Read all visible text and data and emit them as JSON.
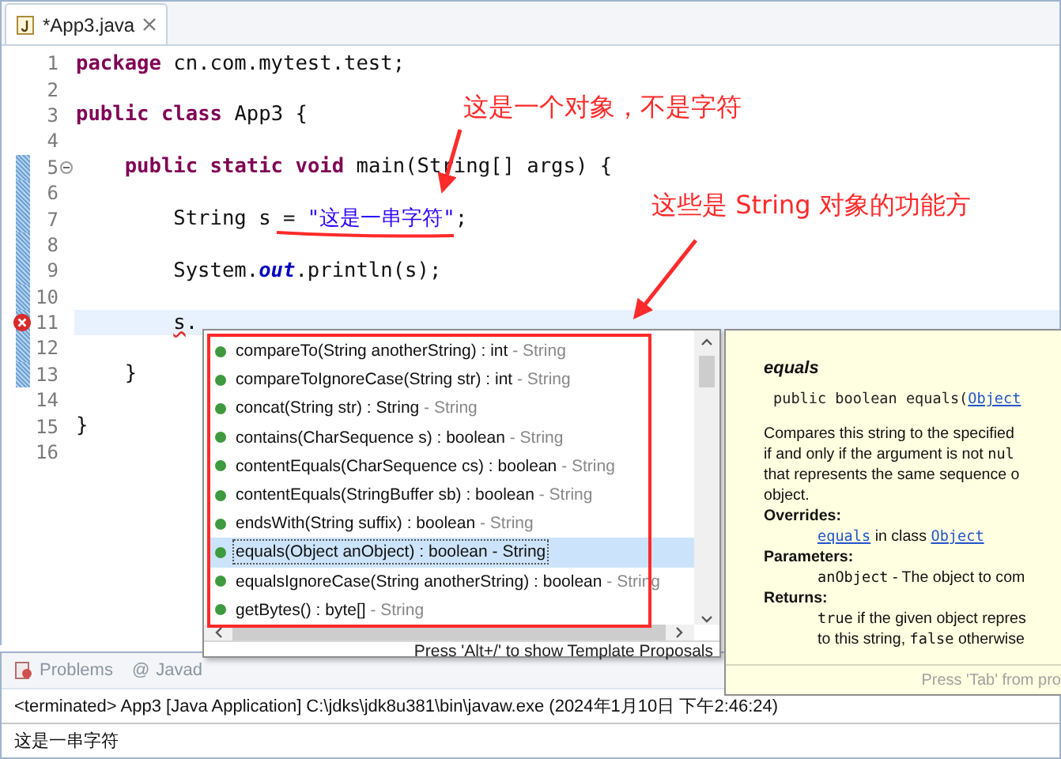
{
  "editor_tab": {
    "title": "*App3.java"
  },
  "code_lines": [
    {
      "number": "1",
      "tokens": [
        {
          "text": "package",
          "kind": "keyword"
        },
        {
          "text": " cn.com.mytest.test;",
          "kind": "plain"
        }
      ],
      "changed": false,
      "foldable": false,
      "error": false,
      "current": false
    },
    {
      "number": "2",
      "changed": false,
      "foldable": false,
      "error": false,
      "current": false
    },
    {
      "number": "3",
      "tokens": [
        {
          "text": "public ",
          "kind": "keyword"
        },
        {
          "text": "class ",
          "kind": "keyword"
        },
        {
          "text": "App3 {",
          "kind": "plain"
        }
      ],
      "changed": false,
      "foldable": false,
      "error": false,
      "current": false
    },
    {
      "number": "4",
      "changed": false,
      "foldable": false,
      "error": false,
      "current": false
    },
    {
      "number": "5",
      "tokens": [
        {
          "text": "    public ",
          "kind": "keyword"
        },
        {
          "text": "static ",
          "kind": "keyword"
        },
        {
          "text": "void",
          "kind": "keyword"
        },
        {
          "text": " main(String[] args) {",
          "kind": "plain"
        }
      ],
      "changed": true,
      "foldable": true,
      "error": false,
      "current": false
    },
    {
      "number": "6",
      "changed": true,
      "foldable": false,
      "error": false,
      "current": false
    },
    {
      "number": "7",
      "tokens": [
        {
          "text": "        String s = ",
          "kind": "plain"
        },
        {
          "text": "\"这是一串字符\"",
          "kind": "string"
        },
        {
          "text": ";",
          "kind": "plain"
        }
      ],
      "changed": true,
      "foldable": false,
      "error": false,
      "current": false
    },
    {
      "number": "8",
      "changed": true,
      "foldable": false,
      "error": false,
      "current": false
    },
    {
      "number": "9",
      "tokens": [
        {
          "text": "        System.",
          "kind": "plain"
        },
        {
          "text": "out",
          "kind": "field"
        },
        {
          "text": ".println(s);",
          "kind": "plain"
        }
      ],
      "changed": true,
      "foldable": false,
      "error": false,
      "current": false
    },
    {
      "number": "10",
      "changed": true,
      "foldable": false,
      "error": false,
      "current": false
    },
    {
      "number": "11",
      "tokens": [
        {
          "text": "        s",
          "kind": "error"
        },
        {
          "text": ".",
          "kind": "plain"
        }
      ],
      "changed": true,
      "foldable": false,
      "error": true,
      "current": true
    },
    {
      "number": "12",
      "changed": true,
      "foldable": false,
      "error": false,
      "current": false
    },
    {
      "number": "13",
      "tokens": [
        {
          "text": "    }",
          "kind": "plain"
        }
      ],
      "changed": true,
      "foldable": false,
      "error": false,
      "current": false
    },
    {
      "number": "14",
      "changed": false,
      "foldable": false,
      "error": false,
      "current": false
    },
    {
      "number": "15",
      "tokens": [
        {
          "text": "}",
          "kind": "plain"
        }
      ],
      "changed": false,
      "foldable": false,
      "error": false,
      "current": false
    },
    {
      "number": "16",
      "changed": false,
      "foldable": false,
      "error": false,
      "current": false
    }
  ],
  "completion_popup": {
    "items": [
      {
        "signature": "compareTo(String anotherString) : int",
        "qualifier": "- String",
        "selected": false
      },
      {
        "signature": "compareToIgnoreCase(String str) : int",
        "qualifier": "- String",
        "selected": false
      },
      {
        "signature": "concat(String str) : String",
        "qualifier": "- String",
        "selected": false
      },
      {
        "signature": "contains(CharSequence s) : boolean",
        "qualifier": "- String",
        "selected": false
      },
      {
        "signature": "contentEquals(CharSequence cs) : boolean",
        "qualifier": "- String",
        "selected": false
      },
      {
        "signature": "contentEquals(StringBuffer sb) : boolean",
        "qualifier": "- String",
        "selected": false
      },
      {
        "signature": "endsWith(String suffix) : boolean",
        "qualifier": "- String",
        "selected": false
      },
      {
        "signature": "equals(Object anObject) : boolean",
        "qualifier": "- String",
        "selected": true
      },
      {
        "signature": "equalsIgnoreCase(String anotherString) : boolean",
        "qualifier": "- String",
        "selected": false
      },
      {
        "signature": "getBytes() : byte[]",
        "qualifier": "- String",
        "selected": false
      }
    ],
    "footer": "Press 'Alt+/' to show Template Proposals"
  },
  "doc_popup": {
    "title": "equals",
    "signature": [
      {
        "text": "public boolean equals(",
        "kind": "code"
      },
      {
        "text": "Object",
        "kind": "link"
      }
    ],
    "lines": [
      {
        "kind": "text",
        "segments": [
          {
            "text": "Compares this string to the specified",
            "kind": "text"
          }
        ]
      },
      {
        "kind": "text",
        "segments": [
          {
            "text": "if and only if the argument is not ",
            "kind": "text"
          },
          {
            "text": "nul",
            "kind": "code"
          }
        ]
      },
      {
        "kind": "text",
        "segments": [
          {
            "text": "that represents the same sequence o",
            "kind": "text"
          }
        ]
      },
      {
        "kind": "text",
        "segments": [
          {
            "text": "object.",
            "kind": "text"
          }
        ]
      },
      {
        "kind": "heading",
        "segments": [
          {
            "text": "Overrides:",
            "kind": "text"
          }
        ]
      },
      {
        "kind": "indent",
        "segments": [
          {
            "text": "equals",
            "kind": "link"
          },
          {
            "text": " in class ",
            "kind": "text"
          },
          {
            "text": "Object",
            "kind": "link"
          }
        ]
      },
      {
        "kind": "heading",
        "segments": [
          {
            "text": "Parameters:",
            "kind": "text"
          }
        ]
      },
      {
        "kind": "indent",
        "segments": [
          {
            "text": "anObject",
            "kind": "code"
          },
          {
            "text": " - The object to com",
            "kind": "text"
          }
        ]
      },
      {
        "kind": "heading",
        "segments": [
          {
            "text": "Returns:",
            "kind": "text"
          }
        ]
      },
      {
        "kind": "indent",
        "segments": [
          {
            "text": "true",
            "kind": "code"
          },
          {
            "text": " if the given object repres",
            "kind": "text"
          }
        ]
      },
      {
        "kind": "indent",
        "segments": [
          {
            "text": "to this string, ",
            "kind": "text"
          },
          {
            "text": "false",
            "kind": "code"
          },
          {
            "text": " otherwise",
            "kind": "text"
          }
        ]
      }
    ],
    "footer": "Press 'Tab' from pro"
  },
  "annotations": [
    {
      "text": "这是一个对象，不是字符"
    },
    {
      "text": "这些是 String 对象的功能方"
    }
  ],
  "bottom_panel": {
    "tabs": [
      {
        "label": "Problems",
        "selected": false
      },
      {
        "label": "Javad",
        "symbol": "@",
        "selected": false
      }
    ],
    "console_header": "<terminated> App3 [Java Application] C:\\jdks\\jdk8u381\\bin\\javaw.exe (2024年1月10日 下午2:46:24)",
    "console_output": "这是一串字符"
  }
}
